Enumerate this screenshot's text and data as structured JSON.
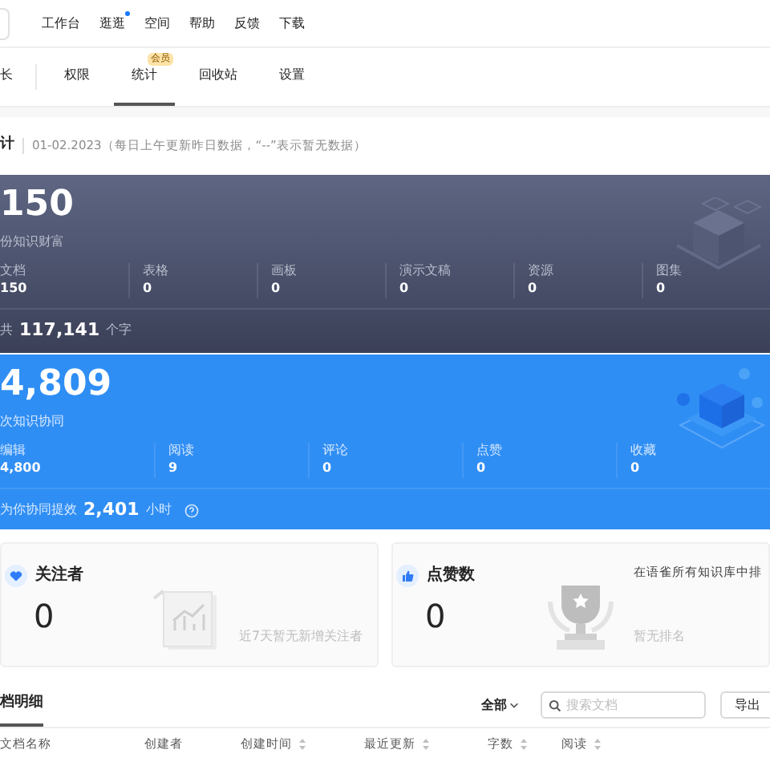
{
  "nav": [
    {
      "label": "工作台",
      "dot": false
    },
    {
      "label": "逛逛",
      "dot": true
    },
    {
      "label": "空间",
      "dot": false
    },
    {
      "label": "帮助",
      "dot": false
    },
    {
      "label": "反馈",
      "dot": false
    },
    {
      "label": "下载",
      "dot": false
    }
  ],
  "tabs": [
    {
      "label": "长",
      "selected": false
    },
    {
      "label": "权限",
      "selected": false
    },
    {
      "label": "统计",
      "selected": true,
      "badge": "会员"
    },
    {
      "label": "回收站",
      "selected": false
    },
    {
      "label": "设置",
      "selected": false
    }
  ],
  "stats_header": {
    "title": "计",
    "note": "01-02.2023（每日上午更新昨日数据，“--”表示暂无数据）"
  },
  "wealth": {
    "total": "150",
    "caption": "份知识财富",
    "items": [
      {
        "label": "文档",
        "value": "150"
      },
      {
        "label": "表格",
        "value": "0"
      },
      {
        "label": "画板",
        "value": "0"
      },
      {
        "label": "演示文稿",
        "value": "0"
      },
      {
        "label": "资源",
        "value": "0"
      },
      {
        "label": "图集",
        "value": "0"
      }
    ],
    "footer_prefix": "共",
    "footer_value": "117,141",
    "footer_suffix": "个字"
  },
  "collab": {
    "total": "4,809",
    "caption": "次知识协同",
    "items": [
      {
        "label": "编辑",
        "value": "4,800"
      },
      {
        "label": "阅读",
        "value": "9"
      },
      {
        "label": "评论",
        "value": "0"
      },
      {
        "label": "点赞",
        "value": "0"
      },
      {
        "label": "收藏",
        "value": "0"
      }
    ],
    "footer_prefix": "为你协同提效",
    "footer_value": "2,401",
    "footer_suffix": "小时"
  },
  "cards": [
    {
      "kind": "followers",
      "title": "关注者",
      "value": "0",
      "note": "近7天暂无新增关注者"
    },
    {
      "kind": "likes",
      "title": "点赞数",
      "value": "0",
      "rank_label": "在语雀所有知识库中排",
      "note": "暂无排名"
    }
  ],
  "detail": {
    "tab": "档明细",
    "filter": "全部",
    "search_placeholder": "搜索文档",
    "export": "导出",
    "columns": [
      {
        "label": "文档名称",
        "sortable": false
      },
      {
        "label": "创建者",
        "sortable": false
      },
      {
        "label": "创建时间",
        "sortable": true
      },
      {
        "label": "最近更新",
        "sortable": true
      },
      {
        "label": "字数",
        "sortable": true
      },
      {
        "label": "阅读",
        "sortable": true
      }
    ]
  }
}
